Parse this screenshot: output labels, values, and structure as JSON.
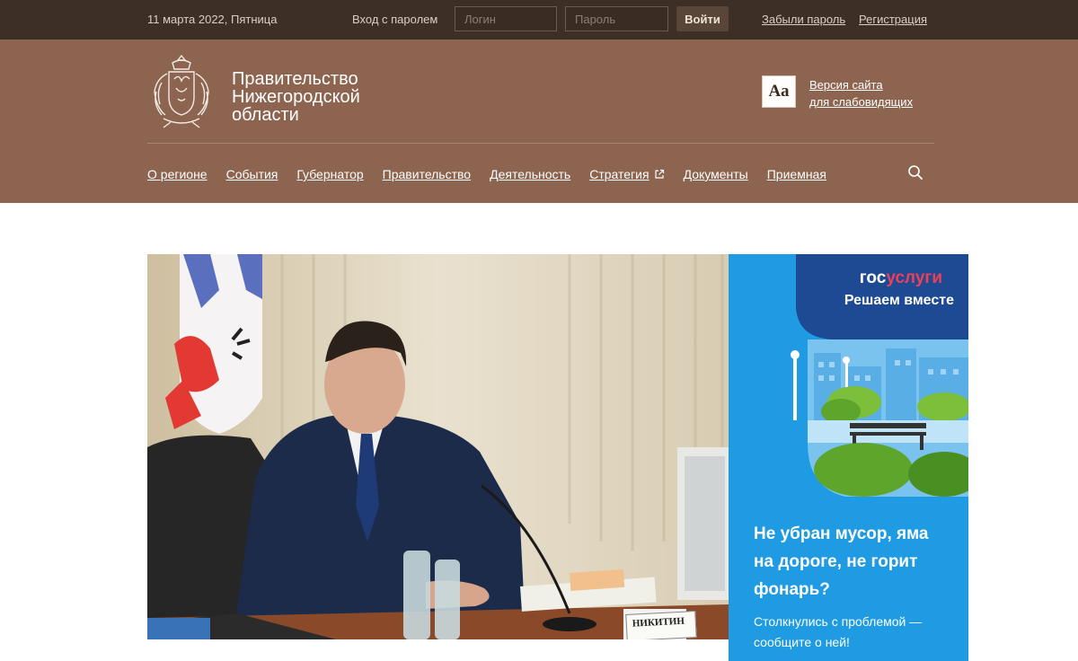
{
  "topbar": {
    "date": "11 марта 2022, Пятница",
    "login_label": "Вход с паролем",
    "login_placeholder": "Логин",
    "password_placeholder": "Пароль",
    "login_button": "Войти",
    "forgot_link": "Забыли пароль",
    "register_link": "Регистрация"
  },
  "header": {
    "title_lines": [
      "Правительство",
      "Нижегородской",
      "области"
    ],
    "accessibility_icon": "Аа",
    "accessibility_link_lines": [
      "Версия сайта",
      "для слабовидящих"
    ],
    "nav": [
      {
        "label": "О регионе"
      },
      {
        "label": "События"
      },
      {
        "label": "Губернатор"
      },
      {
        "label": "Правительство"
      },
      {
        "label": "Деятельность"
      },
      {
        "label": "Стратегия",
        "icon": "external-link-icon"
      },
      {
        "label": "Документы"
      },
      {
        "label": "Приемная"
      }
    ],
    "search_icon": "search-icon"
  },
  "banner": {
    "logo_part1": "гос",
    "logo_part2": "услуги",
    "subtitle": "Решаем вместе",
    "headline_lines": [
      "Не убран мусор, яма",
      "на дороге, не горит",
      "фонарь?"
    ],
    "text_lines": [
      "Столкнулись с проблемой —",
      "сообщите о ней!"
    ],
    "colors": {
      "background": "#1e9be3",
      "accent": "#ee3f58",
      "navy": "#1d4a93"
    }
  },
  "hero": {
    "nameplate": "НИКИТИН"
  },
  "colors": {
    "topbar": "#3d2f26",
    "header": "#8c6450"
  }
}
